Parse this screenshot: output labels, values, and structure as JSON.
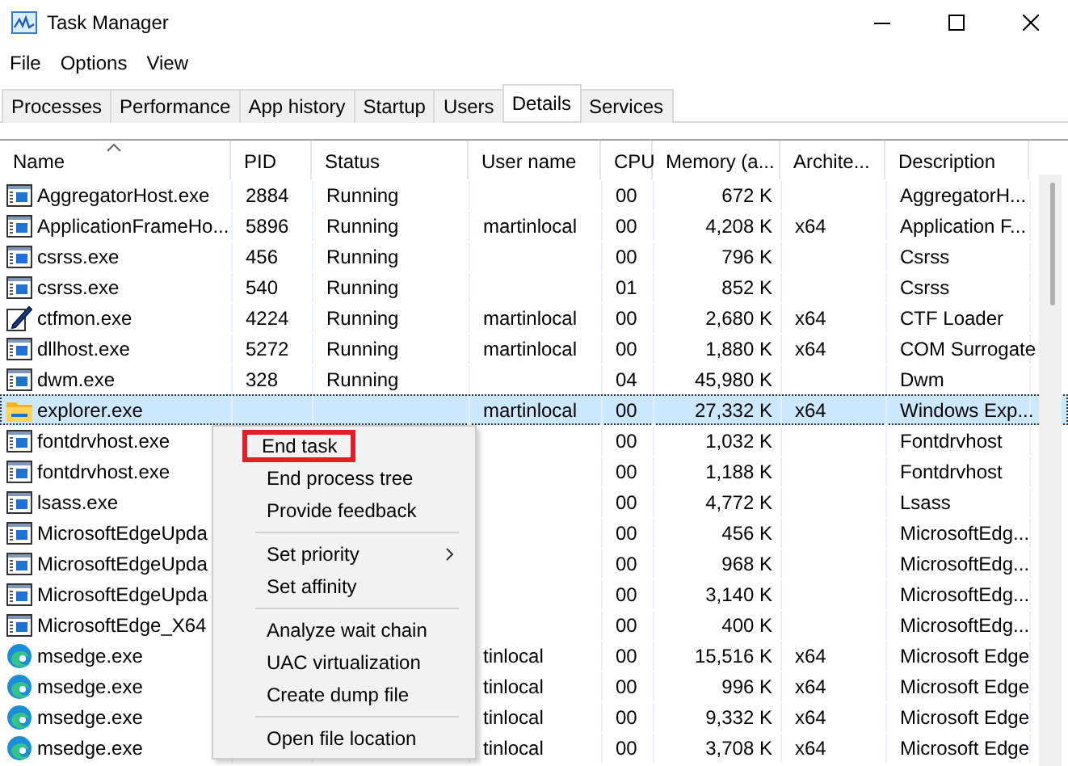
{
  "window": {
    "title": "Task Manager"
  },
  "menu_bar": [
    "File",
    "Options",
    "View"
  ],
  "tabs": [
    {
      "label": "Processes",
      "selected": false
    },
    {
      "label": "Performance",
      "selected": false
    },
    {
      "label": "App history",
      "selected": false
    },
    {
      "label": "Startup",
      "selected": false
    },
    {
      "label": "Users",
      "selected": false
    },
    {
      "label": "Details",
      "selected": true
    },
    {
      "label": "Services",
      "selected": false
    }
  ],
  "table": {
    "columns": [
      {
        "label": "Name",
        "sorted": true
      },
      {
        "label": "PID",
        "sorted": false
      },
      {
        "label": "Status",
        "sorted": false
      },
      {
        "label": "User name",
        "sorted": false
      },
      {
        "label": "CPU",
        "sorted": false
      },
      {
        "label": "Memory (a...",
        "sorted": false
      },
      {
        "label": "Archite...",
        "sorted": false
      },
      {
        "label": "Description",
        "sorted": false
      }
    ],
    "rows": [
      {
        "kind": "app",
        "selected": false,
        "cells": [
          "AggregatorHost.exe",
          "2884",
          "Running",
          null,
          "00",
          "672 K",
          null,
          "AggregatorH..."
        ]
      },
      {
        "kind": "app",
        "selected": false,
        "cells": [
          "ApplicationFrameHo...",
          "5896",
          "Running",
          "martinlocal",
          "00",
          "4,208 K",
          "x64",
          "Application F..."
        ]
      },
      {
        "kind": "app",
        "selected": false,
        "cells": [
          "csrss.exe",
          "456",
          "Running",
          null,
          "00",
          "796 K",
          null,
          "Csrss"
        ]
      },
      {
        "kind": "app",
        "selected": false,
        "cells": [
          "csrss.exe",
          "540",
          "Running",
          null,
          "01",
          "852 K",
          null,
          "Csrss"
        ]
      },
      {
        "kind": "pen",
        "selected": false,
        "cells": [
          "ctfmon.exe",
          "4224",
          "Running",
          "martinlocal",
          "00",
          "2,680 K",
          "x64",
          "CTF Loader"
        ]
      },
      {
        "kind": "app",
        "selected": false,
        "cells": [
          "dllhost.exe",
          "5272",
          "Running",
          "martinlocal",
          "00",
          "1,880 K",
          "x64",
          "COM Surrogate"
        ]
      },
      {
        "kind": "app",
        "selected": false,
        "cells": [
          "dwm.exe",
          "328",
          "Running",
          null,
          "04",
          "45,980 K",
          null,
          "Dwm"
        ]
      },
      {
        "kind": "folder",
        "selected": true,
        "cells": [
          "explorer.exe",
          null,
          null,
          "martinlocal",
          "00",
          "27,332 K",
          "x64",
          "Windows Exp..."
        ]
      },
      {
        "kind": "app",
        "selected": false,
        "cells": [
          "fontdrvhost.exe",
          null,
          null,
          null,
          "00",
          "1,032 K",
          null,
          "Fontdrvhost"
        ]
      },
      {
        "kind": "app",
        "selected": false,
        "cells": [
          "fontdrvhost.exe",
          null,
          null,
          null,
          "00",
          "1,188 K",
          null,
          "Fontdrvhost"
        ]
      },
      {
        "kind": "app",
        "selected": false,
        "cells": [
          "lsass.exe",
          null,
          null,
          null,
          "00",
          "4,772 K",
          null,
          "Lsass"
        ]
      },
      {
        "kind": "app",
        "selected": false,
        "cells": [
          "MicrosoftEdgeUpda",
          null,
          null,
          null,
          "00",
          "456 K",
          null,
          "MicrosoftEdg..."
        ]
      },
      {
        "kind": "app",
        "selected": false,
        "cells": [
          "MicrosoftEdgeUpda",
          null,
          null,
          null,
          "00",
          "968 K",
          null,
          "MicrosoftEdg..."
        ]
      },
      {
        "kind": "app",
        "selected": false,
        "cells": [
          "MicrosoftEdgeUpda",
          null,
          null,
          null,
          "00",
          "3,140 K",
          null,
          "MicrosoftEdg..."
        ]
      },
      {
        "kind": "app",
        "selected": false,
        "cells": [
          "MicrosoftEdge_X64",
          null,
          null,
          null,
          "00",
          "400 K",
          null,
          "MicrosoftEdg..."
        ]
      },
      {
        "kind": "edge",
        "selected": false,
        "cells": [
          "msedge.exe",
          null,
          null,
          "tinlocal",
          "00",
          "15,516 K",
          "x64",
          "Microsoft Edge"
        ]
      },
      {
        "kind": "edge",
        "selected": false,
        "cells": [
          "msedge.exe",
          null,
          null,
          "tinlocal",
          "00",
          "996 K",
          "x64",
          "Microsoft Edge"
        ]
      },
      {
        "kind": "edge",
        "selected": false,
        "cells": [
          "msedge.exe",
          null,
          null,
          "tinlocal",
          "00",
          "9,332 K",
          "x64",
          "Microsoft Edge"
        ]
      },
      {
        "kind": "edge",
        "selected": false,
        "cells": [
          "msedge.exe",
          null,
          null,
          "tinlocal",
          "00",
          "3,708 K",
          "x64",
          "Microsoft Edge"
        ]
      }
    ]
  },
  "context_menu": {
    "groups": [
      [
        {
          "label": "End task",
          "highlighted": true
        },
        {
          "label": "End process tree",
          "highlighted": false
        },
        {
          "label": "Provide feedback",
          "highlighted": false
        }
      ],
      [
        {
          "label": "Set priority",
          "highlighted": false,
          "submenu": true
        },
        {
          "label": "Set affinity",
          "highlighted": false
        }
      ],
      [
        {
          "label": "Analyze wait chain",
          "highlighted": false
        },
        {
          "label": "UAC virtualization",
          "highlighted": false
        },
        {
          "label": "Create dump file",
          "highlighted": false
        }
      ],
      [
        {
          "label": "Open file location",
          "highlighted": false
        }
      ]
    ]
  }
}
